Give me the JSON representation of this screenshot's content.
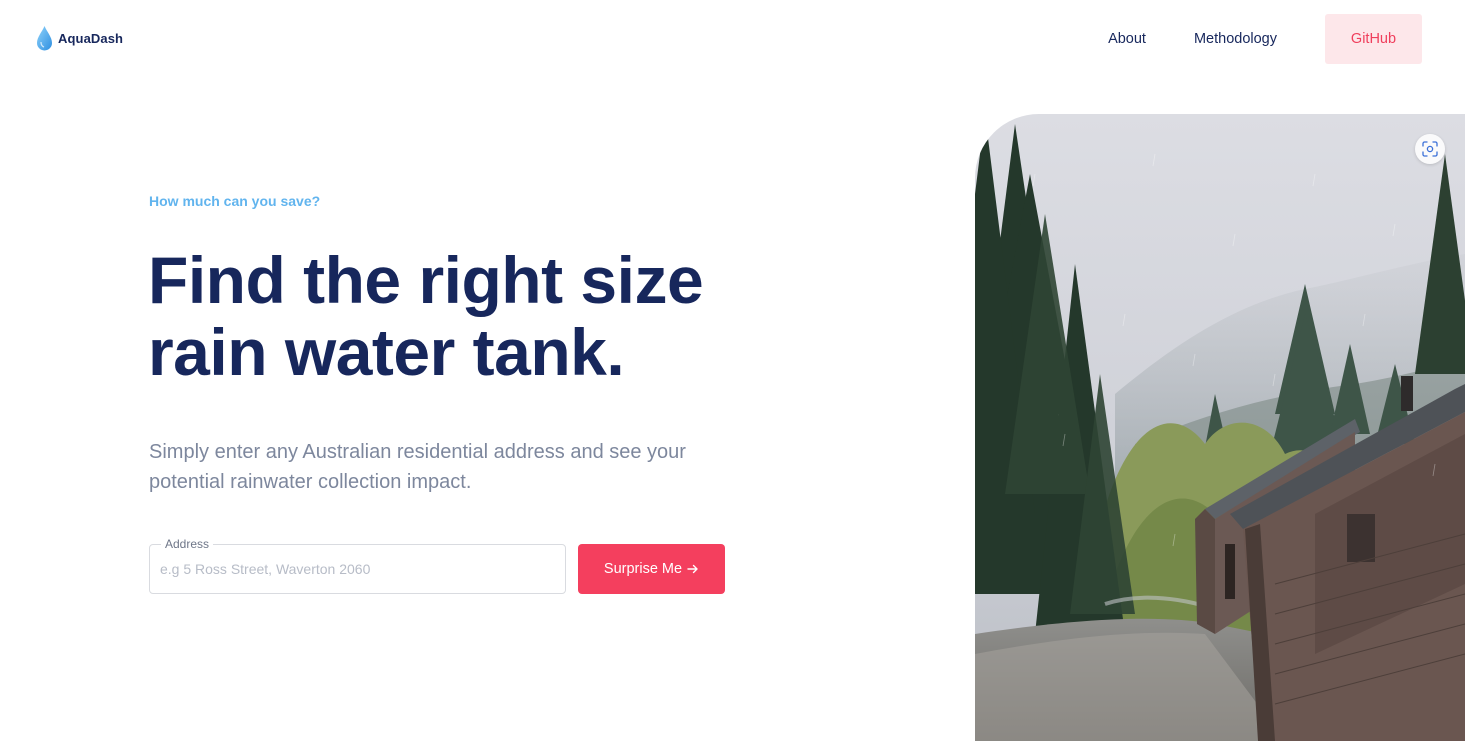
{
  "brand": {
    "name": "AquaDash",
    "icon": "water-drop-icon"
  },
  "nav": {
    "links": [
      "About",
      "Methodology"
    ],
    "github_label": "GitHub"
  },
  "hero": {
    "eyebrow": "How much can you save?",
    "headline_line1": "Find the right size",
    "headline_line2": "rain water tank.",
    "subtitle_line1": "Simply enter any Australian residential address and see your",
    "subtitle_line2": "potential rainwater collection impact."
  },
  "form": {
    "address_label": "Address",
    "address_placeholder": "e.g 5 Ross Street, Waverton 2060",
    "address_value": "",
    "surprise_label": "Surprise Me",
    "surprise_icon": "arrow-right-icon"
  },
  "image": {
    "icon": "visual-search-icon"
  },
  "colors": {
    "navy": "#17275c",
    "accent_red": "#f43f5e",
    "github_bg": "#fde7ea",
    "eyebrow_blue": "#61b4ee",
    "muted": "#7d879d"
  }
}
